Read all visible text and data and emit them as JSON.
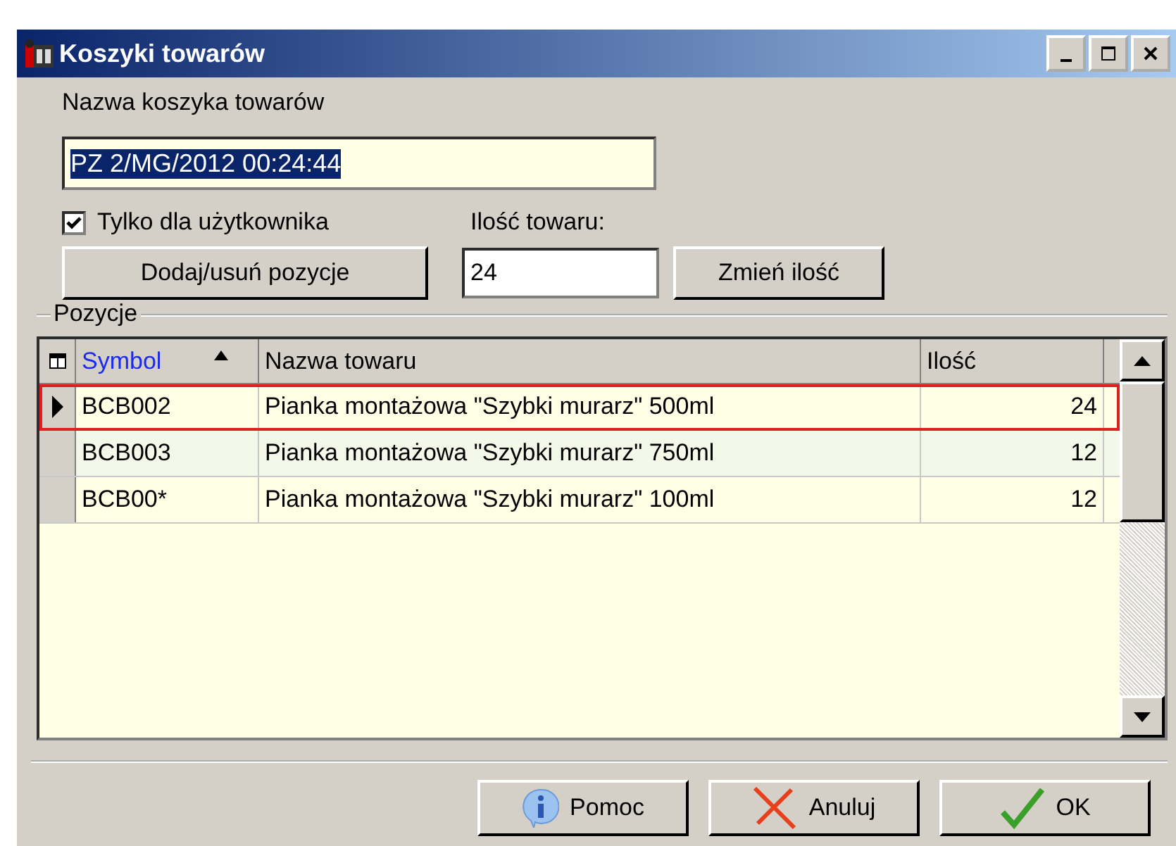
{
  "window": {
    "title": "Koszyki towarów"
  },
  "name_label": "Nazwa koszyka towarów",
  "name_field": {
    "value": "PZ 2/MG/2012 00:24:44"
  },
  "user_only": {
    "label": "Tylko dla użytkownika",
    "checked": true
  },
  "qty_label": "Ilość towaru:",
  "add_button": "Dodaj/usuń pozycje",
  "qty_field": {
    "value": "24"
  },
  "change_button": "Zmień ilość",
  "group_label": "Pozycje",
  "table": {
    "columns": [
      {
        "label": "Symbol",
        "sorted": true
      },
      {
        "label": "Nazwa towaru",
        "sorted": false
      },
      {
        "label": "Ilość",
        "sorted": false
      }
    ],
    "rows": [
      {
        "cells": [
          "BCB002",
          "Pianka montażowa \"Szybki murarz\" 500ml",
          "24"
        ],
        "selected": true
      },
      {
        "cells": [
          "BCB003",
          "Pianka montażowa \"Szybki murarz\" 750ml",
          "12"
        ],
        "selected": false
      },
      {
        "cells": [
          "BCB00*",
          "Pianka montażowa \"Szybki murarz\" 100ml",
          "12"
        ],
        "selected": false
      }
    ]
  },
  "buttons": [
    {
      "kind": "help",
      "label": "Pomoc"
    },
    {
      "kind": "cancel",
      "label": "Anuluj"
    },
    {
      "kind": "ok",
      "label": "OK"
    }
  ]
}
